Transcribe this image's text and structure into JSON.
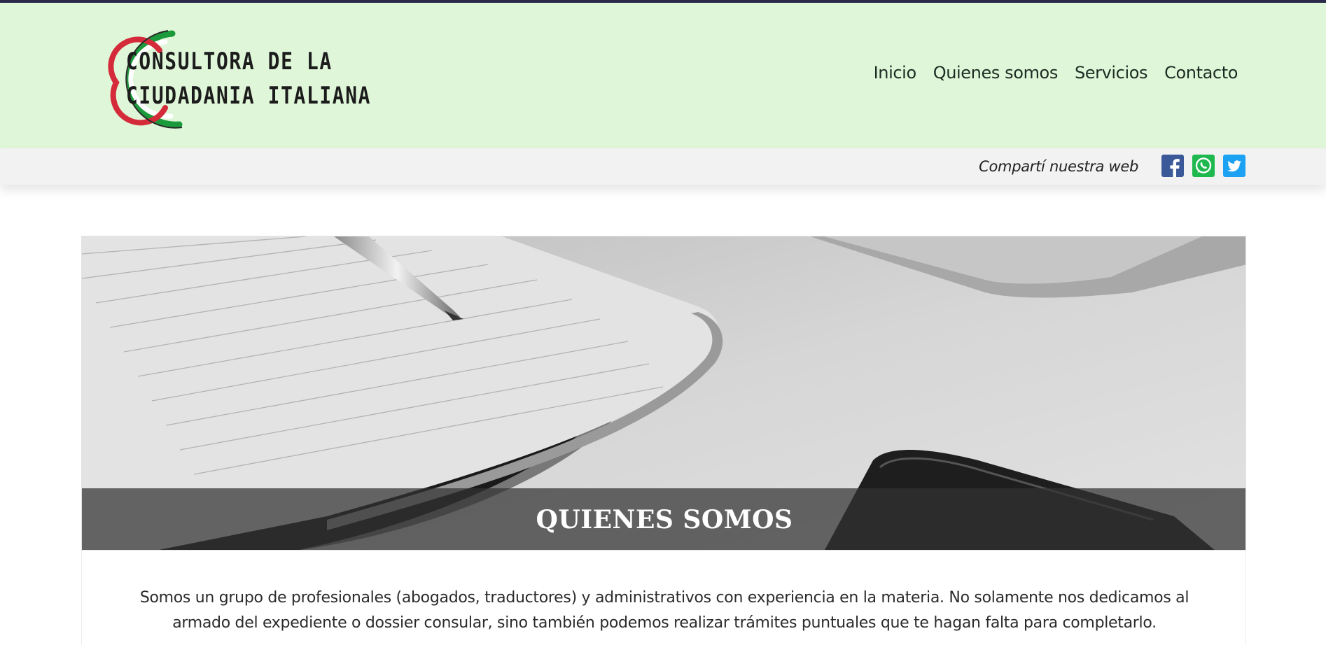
{
  "header": {
    "logo": {
      "line1": "CONSULTORA DE LA",
      "line2": "CIUDADANIA ITALIANA",
      "colors": {
        "green": "#1a9a3a",
        "white": "#ffffff",
        "red": "#d42a3a"
      }
    },
    "nav": [
      {
        "label": "Inicio"
      },
      {
        "label": "Quienes somos"
      },
      {
        "label": "Servicios"
      },
      {
        "label": "Contacto"
      }
    ],
    "background": "#dff7d8"
  },
  "sharebar": {
    "text": "Compartí nuestra web",
    "icons": [
      {
        "name": "facebook-icon",
        "color": "#3b5998"
      },
      {
        "name": "whatsapp-icon",
        "color": "#1eb84e"
      },
      {
        "name": "twitter-icon",
        "color": "#1da1f2"
      }
    ]
  },
  "hero": {
    "title": "QUIENES SOMOS",
    "image": "notebook-pen-photo"
  },
  "content": {
    "paragraph": "Somos un grupo de profesionales (abogados, traductores) y administrativos con experiencia en la materia. No solamente nos dedicamos al armado del expediente o dossier consular, sino también podemos realizar trámites puntuales que te hagan falta para completarlo."
  }
}
